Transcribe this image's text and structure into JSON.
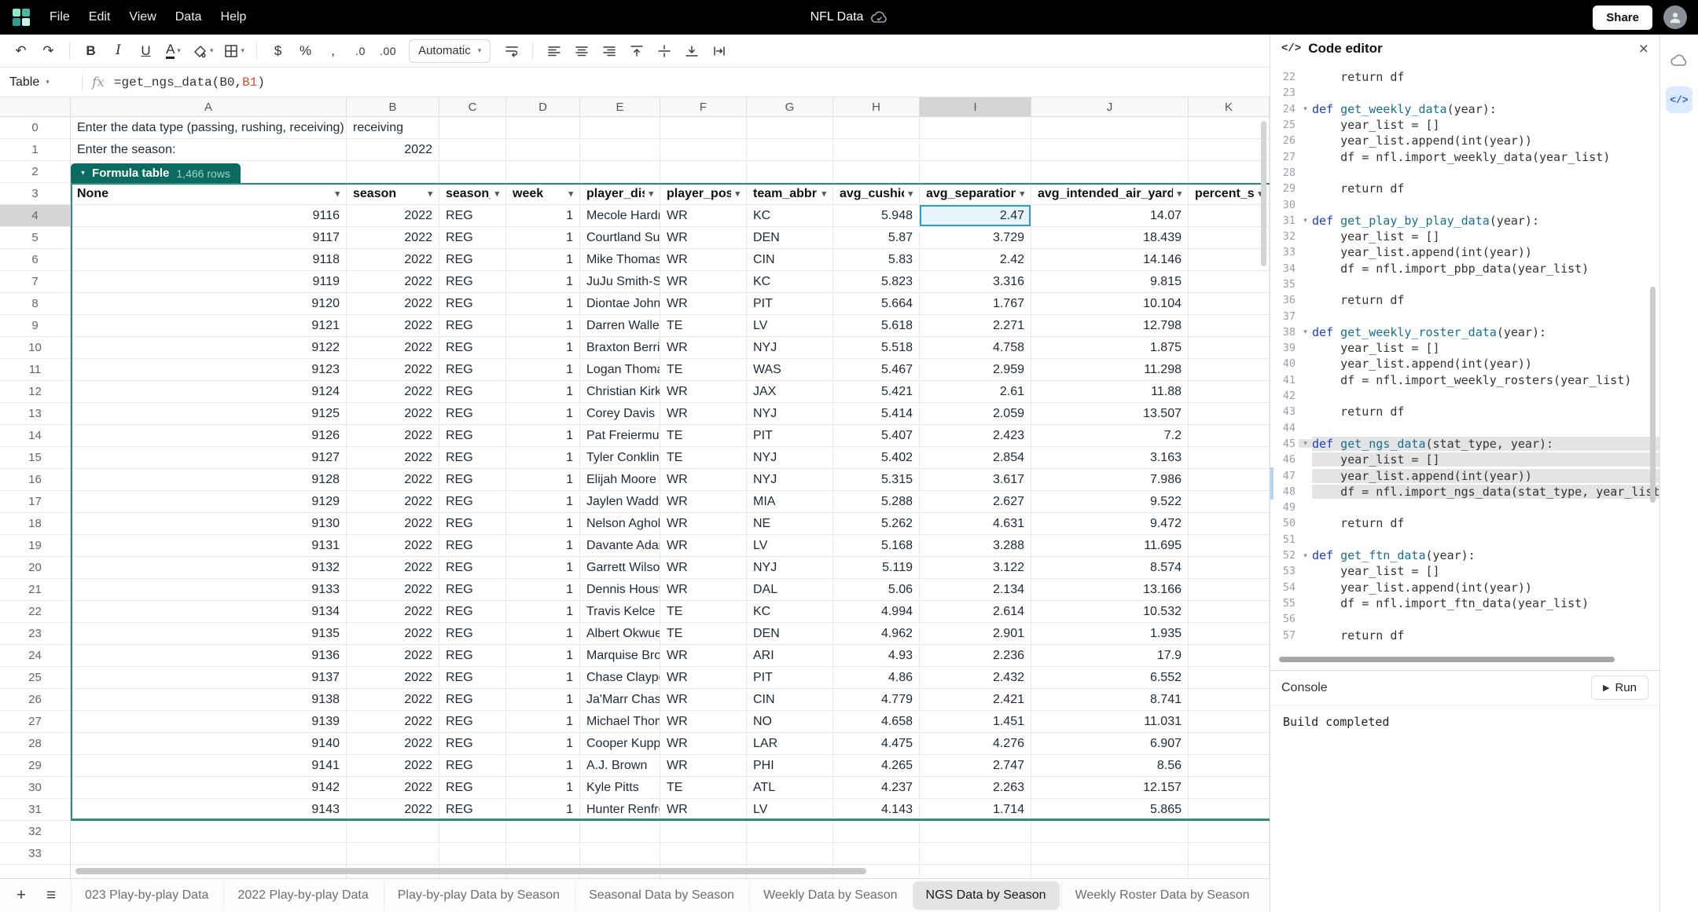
{
  "menubar": {
    "menus": [
      "File",
      "Edit",
      "View",
      "Data",
      "Help"
    ],
    "title": "NFL Data",
    "share_label": "Share"
  },
  "toolbar": {
    "items": [
      {
        "type": "glyph",
        "name": "undo",
        "glyph": "↶"
      },
      {
        "type": "glyph",
        "name": "redo",
        "glyph": "↷"
      },
      {
        "type": "sep"
      },
      {
        "type": "glyph",
        "name": "bold",
        "glyph": "B",
        "style": "bold"
      },
      {
        "type": "glyph",
        "name": "italic",
        "glyph": "I",
        "style": "italic"
      },
      {
        "type": "glyph",
        "name": "underline",
        "glyph": "U",
        "style": "underline"
      },
      {
        "type": "glyph",
        "name": "text-color",
        "glyph": "A",
        "style": "text-color",
        "dropdown": true
      },
      {
        "type": "svg",
        "name": "fill-color",
        "icon": "bucket",
        "dropdown": true
      },
      {
        "type": "svg",
        "name": "borders",
        "icon": "borders",
        "dropdown": true
      },
      {
        "type": "sep"
      },
      {
        "type": "glyph",
        "name": "format-currency",
        "glyph": "$"
      },
      {
        "type": "glyph",
        "name": "format-percent",
        "glyph": "%"
      },
      {
        "type": "glyph",
        "name": "format-comma",
        "glyph": ","
      },
      {
        "type": "glyph",
        "name": "decimal-decrease",
        "glyph": ".0",
        "style": "small"
      },
      {
        "type": "glyph",
        "name": "decimal-increase",
        "glyph": ".00",
        "style": "small"
      },
      {
        "type": "dropdown",
        "name": "number-format",
        "label": "Automatic"
      },
      {
        "type": "svg",
        "name": "text-wrap",
        "icon": "wrap"
      },
      {
        "type": "sep"
      },
      {
        "type": "svg",
        "name": "align-left",
        "icon": "align-left"
      },
      {
        "type": "svg",
        "name": "align-center",
        "icon": "align-center"
      },
      {
        "type": "svg",
        "name": "align-right",
        "icon": "align-right"
      },
      {
        "type": "svg",
        "name": "valign-top",
        "icon": "valign-top"
      },
      {
        "type": "svg",
        "name": "valign-middle",
        "icon": "valign-middle"
      },
      {
        "type": "svg",
        "name": "valign-bottom",
        "icon": "valign-bottom"
      },
      {
        "type": "svg",
        "name": "text-overflow",
        "icon": "overflow"
      }
    ]
  },
  "formula_bar": {
    "selector_label": "Table",
    "fx_label": "fx",
    "formula": {
      "p1": "=get_ngs_data(",
      "ref1": "B0",
      "comma": ", ",
      "ref2": "B1",
      "p2": ")"
    }
  },
  "grid": {
    "col_letters": [
      "A",
      "B",
      "C",
      "D",
      "E",
      "F",
      "G",
      "H",
      "I",
      "J",
      "K"
    ],
    "visible_rows": {
      "from": 0,
      "to": 33
    },
    "selection": {
      "col": "I",
      "row": 4
    },
    "cells_above_table": [
      {
        "row": 0,
        "a": "Enter the data type (passing, rushing, receiving)",
        "b": "receiving"
      },
      {
        "row": 1,
        "a": "Enter the season:",
        "b": "2022"
      }
    ],
    "table_badge": {
      "label": "Formula table",
      "count": "1,466 rows"
    },
    "table_headers": [
      "None",
      "season",
      "season_t",
      "week",
      "player_disp",
      "player_posi",
      "team_abbr",
      "avg_cushio",
      "avg_separation",
      "avg_intended_air_yards",
      "percent_sh"
    ],
    "rows": [
      [
        "9116",
        "2022",
        "REG",
        "1",
        "Mecole Hardma",
        "WR",
        "KC",
        "5.948",
        "2.47",
        "14.07"
      ],
      [
        "9117",
        "2022",
        "REG",
        "1",
        "Courtland Sutto",
        "WR",
        "DEN",
        "5.87",
        "3.729",
        "18.439"
      ],
      [
        "9118",
        "2022",
        "REG",
        "1",
        "Mike Thomas",
        "WR",
        "CIN",
        "5.83",
        "2.42",
        "14.146"
      ],
      [
        "9119",
        "2022",
        "REG",
        "1",
        "JuJu Smith-Sch",
        "WR",
        "KC",
        "5.823",
        "3.316",
        "9.815"
      ],
      [
        "9120",
        "2022",
        "REG",
        "1",
        "Diontae Johnso",
        "WR",
        "PIT",
        "5.664",
        "1.767",
        "10.104"
      ],
      [
        "9121",
        "2022",
        "REG",
        "1",
        "Darren Waller",
        "TE",
        "LV",
        "5.618",
        "2.271",
        "12.798"
      ],
      [
        "9122",
        "2022",
        "REG",
        "1",
        "Braxton Berrios",
        "WR",
        "NYJ",
        "5.518",
        "4.758",
        "1.875"
      ],
      [
        "9123",
        "2022",
        "REG",
        "1",
        "Logan Thomas",
        "TE",
        "WAS",
        "5.467",
        "2.959",
        "11.298"
      ],
      [
        "9124",
        "2022",
        "REG",
        "1",
        "Christian Kirk",
        "WR",
        "JAX",
        "5.421",
        "2.61",
        "11.88"
      ],
      [
        "9125",
        "2022",
        "REG",
        "1",
        "Corey Davis",
        "WR",
        "NYJ",
        "5.414",
        "2.059",
        "13.507"
      ],
      [
        "9126",
        "2022",
        "REG",
        "1",
        "Pat Freiermuth",
        "TE",
        "PIT",
        "5.407",
        "2.423",
        "7.2"
      ],
      [
        "9127",
        "2022",
        "REG",
        "1",
        "Tyler Conklin",
        "TE",
        "NYJ",
        "5.402",
        "2.854",
        "3.163"
      ],
      [
        "9128",
        "2022",
        "REG",
        "1",
        "Elijah Moore",
        "WR",
        "NYJ",
        "5.315",
        "3.617",
        "7.986"
      ],
      [
        "9129",
        "2022",
        "REG",
        "1",
        "Jaylen Waddle",
        "WR",
        "MIA",
        "5.288",
        "2.627",
        "9.522"
      ],
      [
        "9130",
        "2022",
        "REG",
        "1",
        "Nelson Agholor",
        "WR",
        "NE",
        "5.262",
        "4.631",
        "9.472"
      ],
      [
        "9131",
        "2022",
        "REG",
        "1",
        "Davante Adams",
        "WR",
        "LV",
        "5.168",
        "3.288",
        "11.695"
      ],
      [
        "9132",
        "2022",
        "REG",
        "1",
        "Garrett Wilson",
        "WR",
        "NYJ",
        "5.119",
        "3.122",
        "8.574"
      ],
      [
        "9133",
        "2022",
        "REG",
        "1",
        "Dennis Houston",
        "WR",
        "DAL",
        "5.06",
        "2.134",
        "13.166"
      ],
      [
        "9134",
        "2022",
        "REG",
        "1",
        "Travis Kelce",
        "TE",
        "KC",
        "4.994",
        "2.614",
        "10.532"
      ],
      [
        "9135",
        "2022",
        "REG",
        "1",
        "Albert Okwuegt",
        "TE",
        "DEN",
        "4.962",
        "2.901",
        "1.935"
      ],
      [
        "9136",
        "2022",
        "REG",
        "1",
        "Marquise Browr",
        "WR",
        "ARI",
        "4.93",
        "2.236",
        "17.9"
      ],
      [
        "9137",
        "2022",
        "REG",
        "1",
        "Chase Claypool",
        "WR",
        "PIT",
        "4.86",
        "2.432",
        "6.552"
      ],
      [
        "9138",
        "2022",
        "REG",
        "1",
        "Ja'Marr Chase",
        "WR",
        "CIN",
        "4.779",
        "2.421",
        "8.741"
      ],
      [
        "9139",
        "2022",
        "REG",
        "1",
        "Michael Thomas",
        "WR",
        "NO",
        "4.658",
        "1.451",
        "11.031"
      ],
      [
        "9140",
        "2022",
        "REG",
        "1",
        "Cooper Kupp",
        "WR",
        "LAR",
        "4.475",
        "4.276",
        "6.907"
      ],
      [
        "9141",
        "2022",
        "REG",
        "1",
        "A.J. Brown",
        "WR",
        "PHI",
        "4.265",
        "2.747",
        "8.56"
      ],
      [
        "9142",
        "2022",
        "REG",
        "1",
        "Kyle Pitts",
        "TE",
        "ATL",
        "4.237",
        "2.263",
        "12.157"
      ],
      [
        "9143",
        "2022",
        "REG",
        "1",
        "Hunter Renfrow",
        "WR",
        "LV",
        "4.143",
        "1.714",
        "5.865"
      ]
    ]
  },
  "code_editor": {
    "title": "Code editor",
    "highlight_from": 45,
    "highlight_to": 48,
    "marker_lines": [
      47,
      48
    ],
    "lines": [
      {
        "n": 22,
        "t": "    return df"
      },
      {
        "n": 23,
        "t": ""
      },
      {
        "n": 24,
        "t": "def get_weekly_data(year):"
      },
      {
        "n": 25,
        "t": "    year_list = []"
      },
      {
        "n": 26,
        "t": "    year_list.append(int(year))"
      },
      {
        "n": 27,
        "t": "    df = nfl.import_weekly_data(year_list)"
      },
      {
        "n": 28,
        "t": ""
      },
      {
        "n": 29,
        "t": "    return df"
      },
      {
        "n": 30,
        "t": ""
      },
      {
        "n": 31,
        "t": "def get_play_by_play_data(year):"
      },
      {
        "n": 32,
        "t": "    year_list = []"
      },
      {
        "n": 33,
        "t": "    year_list.append(int(year))"
      },
      {
        "n": 34,
        "t": "    df = nfl.import_pbp_data(year_list)"
      },
      {
        "n": 35,
        "t": ""
      },
      {
        "n": 36,
        "t": "    return df"
      },
      {
        "n": 37,
        "t": ""
      },
      {
        "n": 38,
        "t": "def get_weekly_roster_data(year):"
      },
      {
        "n": 39,
        "t": "    year_list = []"
      },
      {
        "n": 40,
        "t": "    year_list.append(int(year))"
      },
      {
        "n": 41,
        "t": "    df = nfl.import_weekly_rosters(year_list)"
      },
      {
        "n": 42,
        "t": ""
      },
      {
        "n": 43,
        "t": "    return df"
      },
      {
        "n": 44,
        "t": ""
      },
      {
        "n": 45,
        "t": "def get_ngs_data(stat_type, year):"
      },
      {
        "n": 46,
        "t": "    year_list = []"
      },
      {
        "n": 47,
        "t": "    year_list.append(int(year))"
      },
      {
        "n": 48,
        "t": "    df = nfl.import_ngs_data(stat_type, year_list)"
      },
      {
        "n": 49,
        "t": ""
      },
      {
        "n": 50,
        "t": "    return df"
      },
      {
        "n": 51,
        "t": ""
      },
      {
        "n": 52,
        "t": "def get_ftn_data(year):"
      },
      {
        "n": 53,
        "t": "    year_list = []"
      },
      {
        "n": 54,
        "t": "    year_list.append(int(year))"
      },
      {
        "n": 55,
        "t": "    df = nfl.import_ftn_data(year_list)"
      },
      {
        "n": 56,
        "t": ""
      },
      {
        "n": 57,
        "t": "    return df"
      }
    ],
    "console": {
      "label": "Console",
      "run_label": "Run",
      "output": "Build completed"
    }
  },
  "sheet_tabs": [
    {
      "label": "023 Play-by-play Data",
      "active": false
    },
    {
      "label": "2022 Play-by-play Data",
      "active": false
    },
    {
      "label": "Play-by-play Data by Season",
      "active": false
    },
    {
      "label": "Seasonal Data by Season",
      "active": false
    },
    {
      "label": "Weekly Data by Season",
      "active": false
    },
    {
      "label": "NGS Data by Season",
      "active": true
    },
    {
      "label": "Weekly Roster Data by Season",
      "active": false
    }
  ],
  "colors": {
    "table_accent": "#2d8c80",
    "table_badge_bg": "#0c6b5f",
    "selection_border": "#2f9dc9",
    "selection_fill": "#e8f4fd",
    "active_panel_icon": "#2563eb",
    "topbar_bg": "#000000"
  }
}
